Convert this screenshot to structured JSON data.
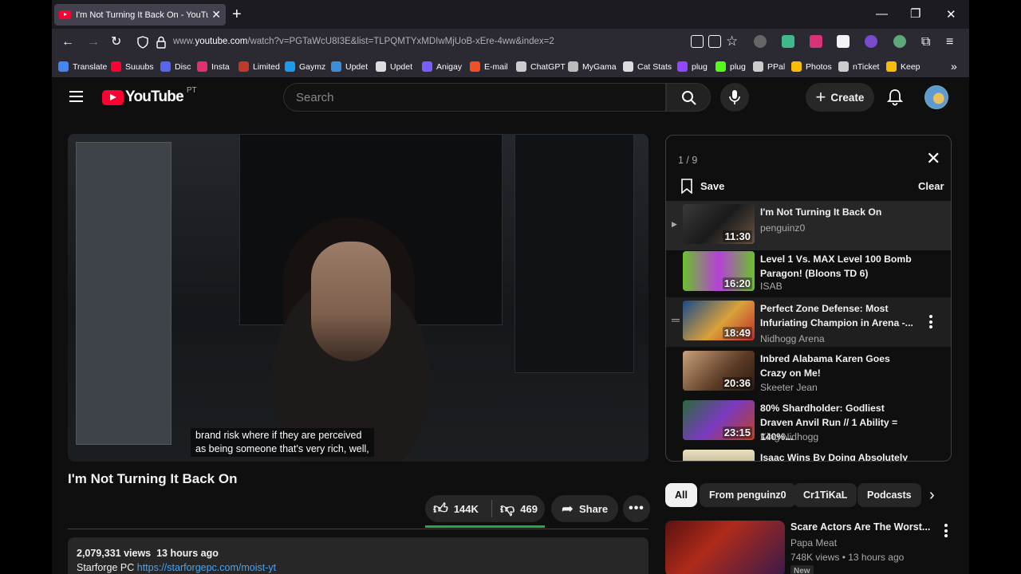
{
  "browser": {
    "tab_title": "I'm Not Turning It Back On - YouTube",
    "url_prefix": "www.",
    "url_domain": "youtube.com",
    "url_path": "/watch?v=PGTaWcU8I3E&list=TLPQMTYxMDIwMjUoB-xEre-4ww&index=2"
  },
  "bookmarks": [
    {
      "label": "Translate",
      "color": "#4285f4"
    },
    {
      "label": "Suuubs",
      "color": "#ff0033"
    },
    {
      "label": "Disc",
      "color": "#5865f2"
    },
    {
      "label": "Insta",
      "color": "#e1306c"
    },
    {
      "label": "Limited",
      "color": "#c0392b"
    },
    {
      "label": "Gaymz",
      "color": "#1b9aee"
    },
    {
      "label": "Updet",
      "color": "#3a8fd8"
    },
    {
      "label": "Updet",
      "color": "#dddddd"
    },
    {
      "label": "Anigay",
      "color": "#7b5cff"
    },
    {
      "label": "E-mail",
      "color": "#f25022"
    },
    {
      "label": "ChatGPT",
      "color": "#cccccc"
    },
    {
      "label": "MyGama",
      "color": "#bbbbbb"
    },
    {
      "label": "Cat Stats",
      "color": "#dddddd"
    },
    {
      "label": "plug",
      "color": "#9146ff"
    },
    {
      "label": "plug",
      "color": "#53fc18"
    },
    {
      "label": "PPal",
      "color": "#cccccc"
    },
    {
      "label": "Photos",
      "color": "#fbbc05"
    },
    {
      "label": "nTicket",
      "color": "#cccccc"
    },
    {
      "label": "Keep",
      "color": "#fbbc04"
    }
  ],
  "header": {
    "logo_text": "YouTube",
    "country": "PT",
    "search_placeholder": "Search",
    "create_label": "Create"
  },
  "video": {
    "caption_line1": "brand risk where if they are perceived",
    "caption_line2": "as being someone that's very rich, well,",
    "title": "I'm Not Turning It Back On",
    "likes": "144K",
    "dislikes": "469",
    "share_label": "Share",
    "views": "2,079,331 views",
    "age": "13 hours ago",
    "desc_prefix": "Starforge PC",
    "desc_link": "https://starforgepc.com/moist-yt"
  },
  "playlist": {
    "position": "1 / 9",
    "save_label": "Save",
    "clear_label": "Clear",
    "items": [
      {
        "title": "I'm Not Turning It Back On",
        "channel": "penguinz0",
        "duration": "11:30"
      },
      {
        "title": "Level 1 Vs. MAX Level 100 Bomb Paragon! (Bloons TD 6)",
        "channel": "ISAB",
        "duration": "16:20"
      },
      {
        "title": "Perfect Zone Defense: Most Infuriating Champion in Arena -...",
        "channel": "Nidhogg Arena",
        "duration": "18:49"
      },
      {
        "title": "Inbred Alabama Karen Goes Crazy on Me!",
        "channel": "Skeeter Jean",
        "duration": "20:36"
      },
      {
        "title": "80% Shardholder: Godliest Draven Anvil Run // 1 Ability = 140%...",
        "channel": "King Nidhogg",
        "duration": "23:15"
      },
      {
        "title": "Isaac Wins By Doing Absolutely",
        "channel": "",
        "duration": ""
      }
    ]
  },
  "chips": [
    "All",
    "From penguinz0",
    "Cr1TiKaL",
    "Podcasts"
  ],
  "recommended": {
    "title": "Scare Actors Are The Worst...",
    "channel": "Papa Meat",
    "meta": "748K views • 13 hours ago",
    "badge": "New"
  },
  "colors": {
    "yt_red": "#ff0033",
    "like_bar": "#2ba640",
    "link": "#3ea6ff"
  }
}
